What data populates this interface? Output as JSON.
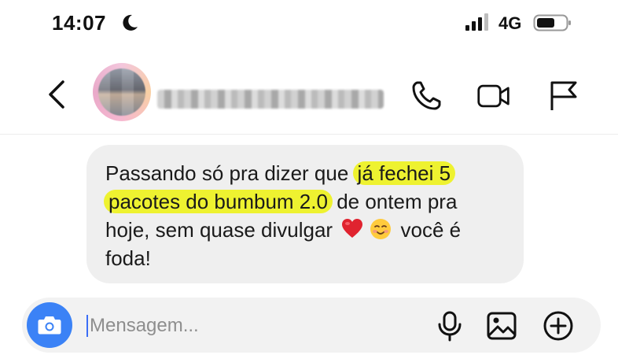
{
  "status_bar": {
    "time": "14:07",
    "network": "4G",
    "icons": [
      "moon-icon",
      "signal-bars-icon",
      "battery-icon"
    ]
  },
  "header": {
    "icons": [
      "chevron-left-icon",
      "phone-icon",
      "video-camera-icon",
      "flag-icon"
    ]
  },
  "message": {
    "text_before": "Passando só pra dizer que",
    "highlight_line1": "já fechei 5",
    "highlight_line2": "pacotes do bumbum 2.0",
    "text_after": "de ontem pra hoje, sem quase divulgar",
    "emojis": [
      "red-heart-emoji",
      "smiling-face-emoji"
    ],
    "text_end": "você é foda!",
    "highlight_color": "#eef230",
    "bubble_color": "#efefef"
  },
  "composer": {
    "placeholder": "Mensagem...",
    "value": "",
    "camera_color": "#3b82f6",
    "icons": [
      "camera-icon",
      "microphone-icon",
      "image-icon",
      "plus-circle-icon"
    ]
  }
}
